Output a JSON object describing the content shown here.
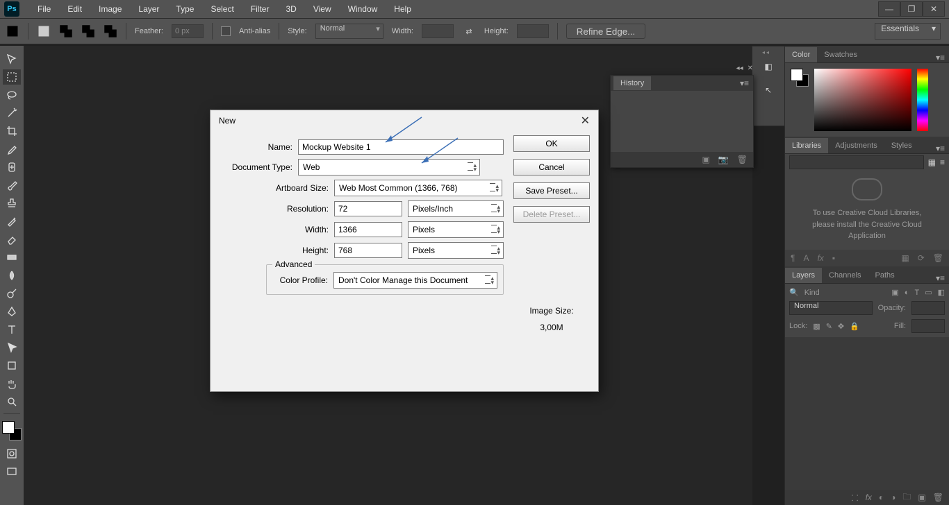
{
  "app": {
    "logo": "Ps"
  },
  "menu": [
    "File",
    "Edit",
    "Image",
    "Layer",
    "Type",
    "Select",
    "Filter",
    "3D",
    "View",
    "Window",
    "Help"
  ],
  "options": {
    "feather_label": "Feather:",
    "feather_value": "0 px",
    "aa_label": "Anti-alias",
    "style_label": "Style:",
    "style_value": "Normal",
    "width_label": "Width:",
    "height_label": "Height:",
    "refine": "Refine Edge...",
    "workspace": "Essentials"
  },
  "panels": {
    "color_tab": "Color",
    "swatches_tab": "Swatches",
    "libraries_tab": "Libraries",
    "adjustments_tab": "Adjustments",
    "styles_tab": "Styles",
    "libs_msg1": "To use Creative Cloud Libraries,",
    "libs_msg2": "please install the Creative Cloud",
    "libs_msg3": "Application",
    "layers_tab": "Layers",
    "channels_tab": "Channels",
    "paths_tab": "Paths",
    "kind": "Kind",
    "blend": "Normal",
    "opacity_label": "Opacity:",
    "lock_label": "Lock:",
    "fill_label": "Fill:"
  },
  "history": {
    "title": "History"
  },
  "dialog": {
    "title": "New",
    "name_label": "Name:",
    "name_value": "Mockup Website 1",
    "doctype_label": "Document Type:",
    "doctype_value": "Web",
    "artboard_label": "Artboard Size:",
    "artboard_value": "Web Most Common (1366, 768)",
    "res_label": "Resolution:",
    "res_value": "72",
    "res_unit": "Pixels/Inch",
    "width_label": "Width:",
    "width_value": "1366",
    "width_unit": "Pixels",
    "height_label": "Height:",
    "height_value": "768",
    "height_unit": "Pixels",
    "advanced": "Advanced",
    "profile_label": "Color Profile:",
    "profile_value": "Don't Color Manage this Document",
    "ok": "OK",
    "cancel": "Cancel",
    "save_preset": "Save Preset...",
    "delete_preset": "Delete Preset...",
    "imgsize_label": "Image Size:",
    "imgsize_value": "3,00M"
  }
}
